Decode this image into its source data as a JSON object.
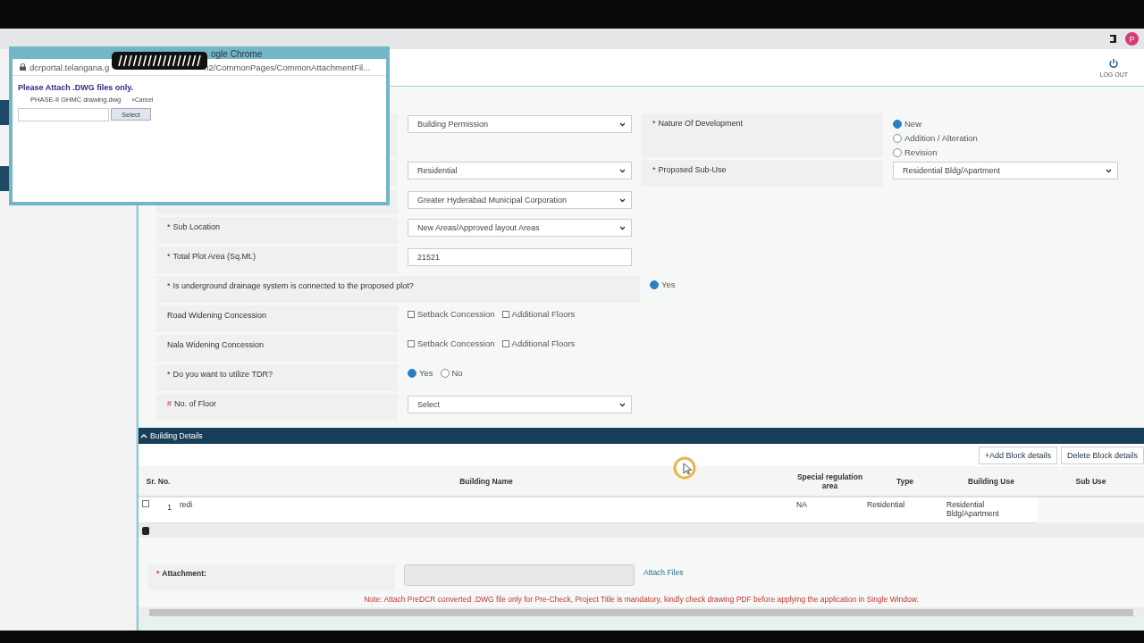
{
  "browser": {
    "avatar": "P"
  },
  "header": {
    "logout": "LOG OUT"
  },
  "popup": {
    "title": "ogle Chrome",
    "url_start": "dcrportal.telangana.g",
    "url_end": "n2/CommonPages/CommonAttachmentFil...",
    "heading": "Please Attach .DWG files only.",
    "file": "PHASE-II GHMC drawing.dwg",
    "cancel": "×Cancel",
    "select_button": "Select"
  },
  "form": {
    "rows": [
      {
        "field": {
          "kind": "select",
          "value": "Building Permission"
        },
        "marker2": "*",
        "label2": "Nature Of Development",
        "field2": {
          "kind": "radio_list",
          "options": [
            {
              "label": "New",
              "selected": true
            },
            {
              "label": "Addition / Alteration",
              "selected": false
            },
            {
              "label": "Revision",
              "selected": false
            }
          ]
        }
      },
      {
        "field": {
          "kind": "select",
          "value": "Residential"
        },
        "marker2": "*",
        "label2": "Proposed Sub-Use",
        "field2": {
          "kind": "select",
          "value": "Residential Bldg/Apartment"
        }
      },
      {
        "field": {
          "kind": "select",
          "value": "Greater Hyderabad Municipal Corporation"
        }
      },
      {
        "marker": "*",
        "label": "Sub Location",
        "field": {
          "kind": "select",
          "value": "New Areas/Approved layout Areas"
        }
      },
      {
        "marker": "*",
        "label": "Total Plot Area (Sq.Mt.)",
        "field": {
          "kind": "text",
          "value": "21521"
        }
      },
      {
        "kind": "wide",
        "marker": "*",
        "label": "Is underground drainage system is connected to the proposed plot?",
        "field": {
          "kind": "radio",
          "options": [
            {
              "label": "Yes",
              "selected": true
            }
          ]
        }
      },
      {
        "label": "Road Widening Concession",
        "field": {
          "kind": "checkbox",
          "options": [
            {
              "label": "Setback Concession",
              "checked": false
            },
            {
              "label": "Additional Floors",
              "checked": false
            }
          ]
        }
      },
      {
        "label": "Nala Widening Concession",
        "field": {
          "kind": "checkbox",
          "options": [
            {
              "label": "Setback Concession",
              "checked": false
            },
            {
              "label": "Additional Floors",
              "checked": false
            }
          ]
        }
      },
      {
        "marker": "*",
        "label": "Do you want to utilize TDR?",
        "field": {
          "kind": "radio",
          "options": [
            {
              "label": "Yes",
              "selected": true
            },
            {
              "label": "No",
              "selected": false
            }
          ]
        }
      },
      {
        "marker": "#",
        "label": "No. of Floor",
        "field": {
          "kind": "select",
          "value": "Select"
        }
      }
    ]
  },
  "building_details": {
    "title": "Building Details",
    "buttons": [
      "+Add Block details",
      "Delete Block details"
    ],
    "columns": [
      "Sr. No.",
      "Building Name",
      "Special regulation area",
      "Type",
      "Building Use",
      "Sub Use"
    ],
    "rows": [
      {
        "checked": false,
        "cells": [
          "1",
          "redi",
          "NA",
          "Residential",
          "Residential Bldg/Apartment"
        ]
      }
    ]
  },
  "attachment": {
    "marker": "*",
    "label": "Attachment:",
    "link": "Attach Files",
    "note": "Note: Attach PreDCR converted .DWG file only for Pre-Check, Project Title is mandatory, kindly check drawing PDF before applying the application in Single Window."
  }
}
